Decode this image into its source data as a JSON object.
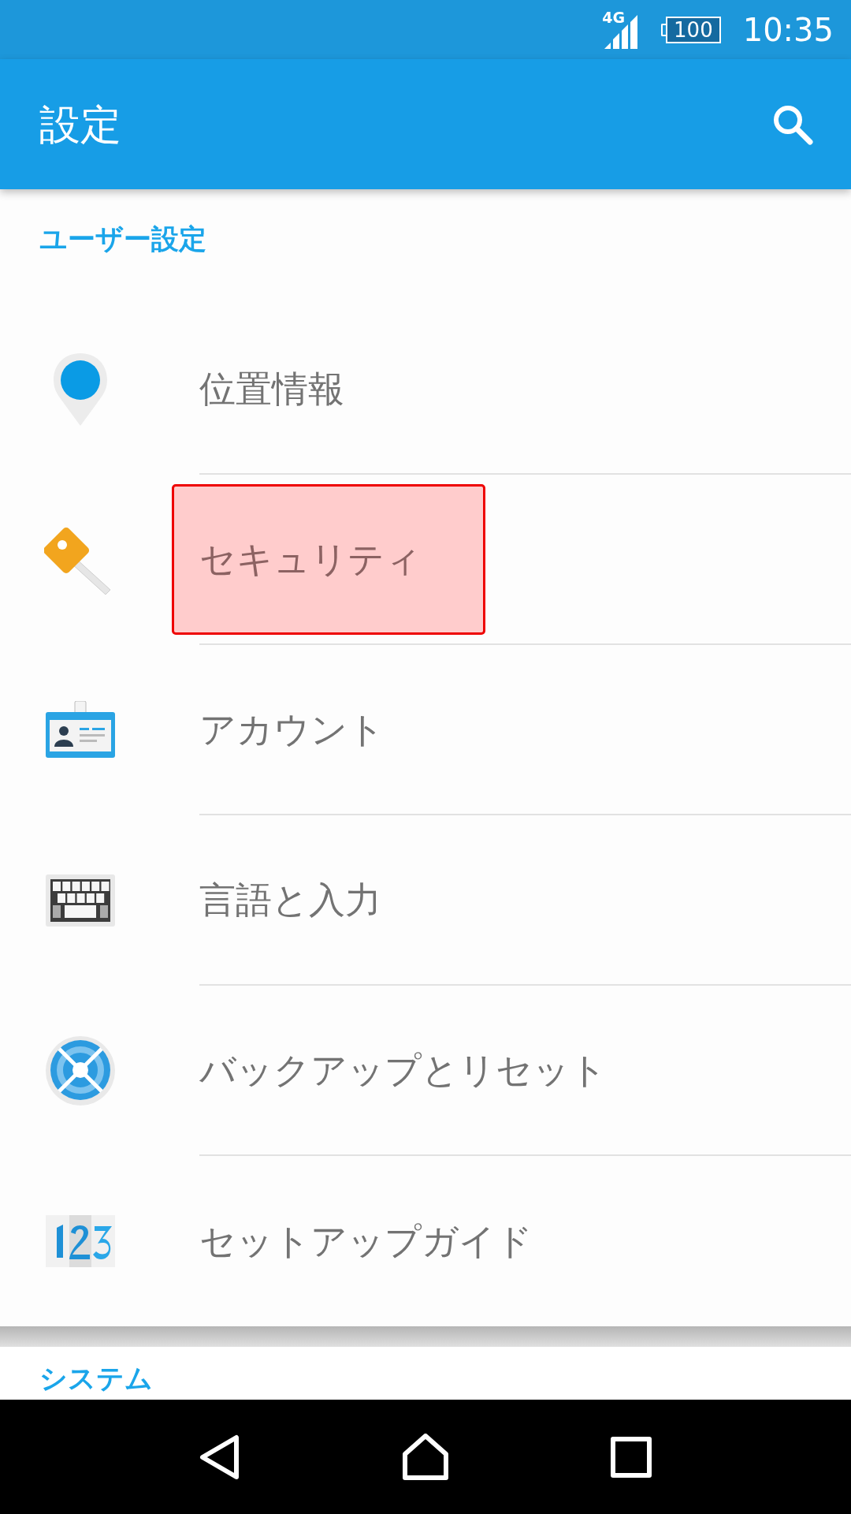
{
  "status_bar": {
    "network": "4G",
    "battery": "100",
    "time": "10:35"
  },
  "app_bar": {
    "title": "設定"
  },
  "sections": [
    {
      "header": "ユーザー設定",
      "items": [
        {
          "label": "位置情報",
          "kind": "location",
          "highlighted": false
        },
        {
          "label": "セキュリティ",
          "kind": "security",
          "highlighted": true
        },
        {
          "label": "アカウント",
          "kind": "account",
          "highlighted": false
        },
        {
          "label": "言語と入力",
          "kind": "keyboard",
          "highlighted": false
        },
        {
          "label": "バックアップとリセット",
          "kind": "backup",
          "highlighted": false
        },
        {
          "label": "セットアップガイド",
          "kind": "guide",
          "highlighted": false
        }
      ]
    },
    {
      "header": "システム"
    }
  ]
}
